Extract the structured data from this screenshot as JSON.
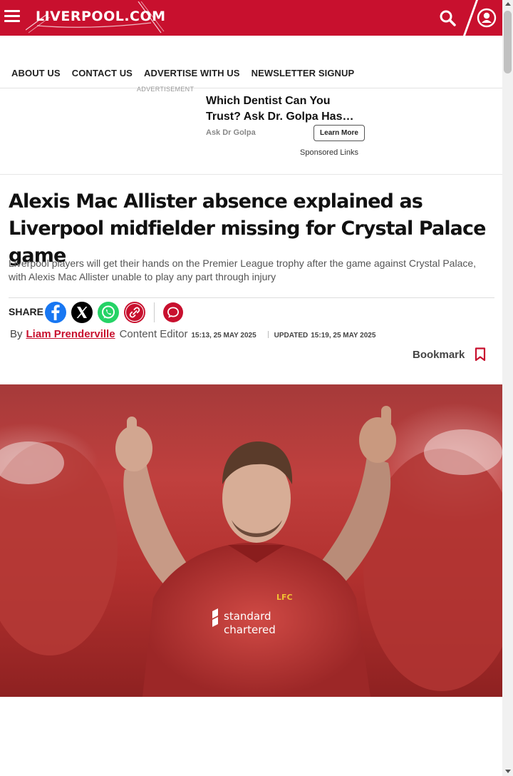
{
  "header": {
    "logo_text": "LIVERPOOL.COM",
    "menu_icon": "hamburger-menu-icon",
    "search_icon": "search-icon",
    "account_icon": "user-account-icon",
    "brand_color": "#c8102e"
  },
  "nav": {
    "items": [
      {
        "label": "ABOUT US"
      },
      {
        "label": "CONTACT US"
      },
      {
        "label": "ADVERTISE WITH US"
      },
      {
        "label": "NEWSLETTER SIGNUP"
      }
    ]
  },
  "ad": {
    "label": "ADVERTISEMENT",
    "headline": "Which Dentist Can You Trust? Ask Dr. Golpa Has…",
    "source": "Ask Dr Golpa",
    "cta": "Learn More",
    "sponsored": "Sponsored Links"
  },
  "article": {
    "headline": "Alexis Mac Allister absence explained as Liverpool midfielder missing for Crystal Palace game",
    "standfirst": "Liverpool players will get their hands on the Premier League trophy after the game against Crystal Palace, with Alexis Mac Allister unable to play any part through injury",
    "share": {
      "label": "SHARE",
      "icons": [
        "facebook-icon",
        "x-twitter-icon",
        "whatsapp-icon",
        "copy-link-icon",
        "comments-icon"
      ]
    },
    "byline": {
      "by": "By",
      "author": "Liam Prenderville",
      "role": "Content Editor",
      "published": "15:13, 25 MAY 2025",
      "updated_label": "UPDATED",
      "updated": "15:19, 25 MAY 2025"
    },
    "bookmark": {
      "label": "Bookmark"
    },
    "hero": {
      "kit_sponsor": "standard chartered",
      "crest": "LFC"
    }
  }
}
